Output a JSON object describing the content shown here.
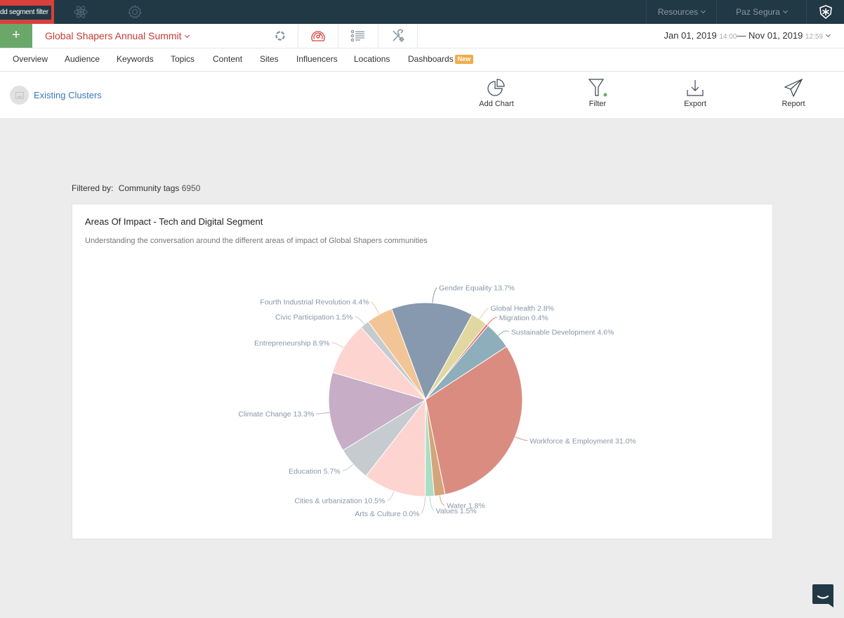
{
  "topbar": {
    "tooltip": "dd segment filter",
    "icons": [
      "atom-icon",
      "gear-icon"
    ],
    "resources_label": "Resources",
    "user_label": "Paz Segura",
    "brand_icon": "brand-badge-icon"
  },
  "subbar": {
    "add_label": "+",
    "project_title": "Global Shapers Annual Summit",
    "tools": [
      "refresh-icon",
      "gauge-icon",
      "list-icon",
      "tools-icon"
    ],
    "date_start": "Jan 01, 2019",
    "time_start": "14:00",
    "date_separator": "—",
    "date_end": "Nov 01, 2019",
    "time_end": "12:59"
  },
  "nav": {
    "tabs": [
      "Overview",
      "Audience",
      "Keywords",
      "Topics",
      "Content",
      "Sites",
      "Influencers",
      "Locations",
      "Dashboards"
    ],
    "new_badge": "New"
  },
  "toolbar": {
    "clusters_label": "Existing Clusters",
    "actions": [
      {
        "label": "Add Chart",
        "icon": "pie-chart-icon"
      },
      {
        "label": "Filter",
        "icon": "filter-icon"
      },
      {
        "label": "Export",
        "icon": "download-icon"
      },
      {
        "label": "Report",
        "icon": "paper-plane-icon"
      }
    ],
    "filter_active_color": "#6aa86a"
  },
  "filter": {
    "key": "Filtered by:",
    "tag": "Community tags",
    "count": "6950"
  },
  "card": {
    "title": "Areas Of Impact - Tech and Digital Segment",
    "subtitle": "Understanding the conversation around the different areas of impact of Global Shapers communities"
  },
  "chart_data": {
    "type": "pie",
    "title": "Areas Of Impact - Tech and Digital Segment",
    "subtitle": "Understanding the conversation around the different areas of impact of Global Shapers communities",
    "unit": "%",
    "start_angle_deg": -20.5,
    "slices": [
      {
        "name": "Gender Equality",
        "value": 13.7,
        "color": "#8799ae"
      },
      {
        "name": "Global Health",
        "value": 2.8,
        "color": "#e0d8a0"
      },
      {
        "name": "Migration",
        "value": 0.4,
        "color": "#e06f6a"
      },
      {
        "name": "Sustainable Development",
        "value": 4.6,
        "color": "#8eaebb"
      },
      {
        "name": "Workforce & Employment",
        "value": 31.0,
        "color": "#da8c80"
      },
      {
        "name": "Water",
        "value": 1.8,
        "color": "#d4a57a"
      },
      {
        "name": "Values",
        "value": 1.5,
        "color": "#acdcc4"
      },
      {
        "name": "Arts & Culture",
        "value": 0.0,
        "color": "#c9c9c9"
      },
      {
        "name": "Cities & urbanization",
        "value": 10.5,
        "color": "#fdd4cf"
      },
      {
        "name": "Education",
        "value": 5.7,
        "color": "#c5cbcf"
      },
      {
        "name": "Climate Change",
        "value": 13.3,
        "color": "#c7adc6"
      },
      {
        "name": "Entrepreneurship",
        "value": 8.9,
        "color": "#fdd4cf"
      },
      {
        "name": "Civic Participation",
        "value": 1.5,
        "color": "#c5cbcf"
      },
      {
        "name": "Fourth Industrial Revolution",
        "value": 4.4,
        "color": "#f3c596"
      }
    ]
  }
}
